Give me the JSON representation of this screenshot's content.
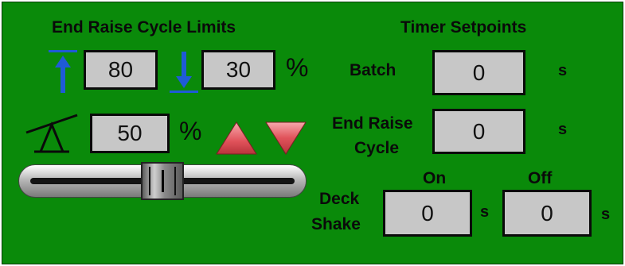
{
  "limits": {
    "title": "End Raise Cycle Limits",
    "upper_value": "80",
    "lower_value": "30",
    "percent_sign": "%",
    "upper_icon": "up-arrow-icon",
    "lower_icon": "down-arrow-icon"
  },
  "tilt": {
    "icon": "seesaw-tilt-icon",
    "value": "50",
    "percent_sign": "%",
    "increase_icon": "triangle-up-icon",
    "decrease_icon": "triangle-down-icon",
    "slider_level": 0.5
  },
  "timers": {
    "title": "Timer Setpoints",
    "batch": {
      "label": "Batch",
      "value": "0",
      "unit": "s"
    },
    "end_raise": {
      "label_line1": "End Raise",
      "label_line2": "Cycle",
      "value": "0",
      "unit": "s"
    },
    "deck_shake": {
      "label_line1": "Deck",
      "label_line2": "Shake",
      "on_label": "On",
      "off_label": "Off",
      "on_value": "0",
      "off_value": "0",
      "on_unit": "s",
      "off_unit": "s"
    }
  },
  "colors": {
    "panel_background": "#0a8a0a",
    "field_background": "#c7c7c7",
    "arrow_blue": "#1f5bd6",
    "triangle_red": "#e0525a"
  }
}
